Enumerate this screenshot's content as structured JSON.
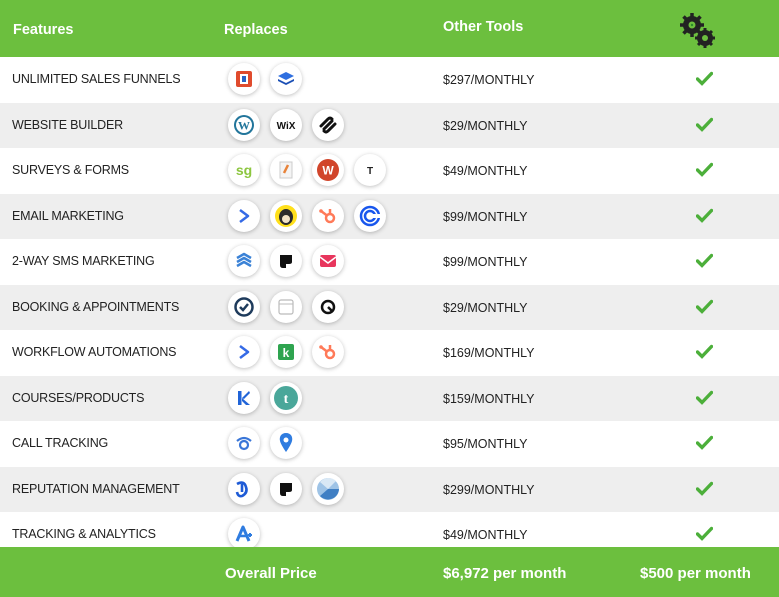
{
  "header": {
    "features": "Features",
    "replaces": "Replaces",
    "other_tools": "Other Tools",
    "logo_icon": "gears-logo-icon"
  },
  "colors": {
    "brand_green": "#6cbf3e",
    "check_green": "#4caf3a",
    "row_alt": "#eeeeee"
  },
  "rows": [
    {
      "feature": "UNLIMITED SALES FUNNELS",
      "price": "$297/MONTHLY",
      "icons": [
        "clickfunnels-icon",
        "layers-stack-icon"
      ]
    },
    {
      "feature": "WEBSITE BUILDER",
      "price": "$29/MONTHLY",
      "icons": [
        "wordpress-icon",
        "wix-icon",
        "squarespace-icon"
      ]
    },
    {
      "feature": "SURVEYS & FORMS",
      "price": "$49/MONTHLY",
      "icons": [
        "surveygizmo-icon",
        "forms-icon",
        "wufoo-icon",
        "typeform-icon"
      ]
    },
    {
      "feature": "EMAIL MARKETING",
      "price": "$99/MONTHLY",
      "icons": [
        "activecampaign-icon",
        "mailchimp-icon",
        "hubspot-icon",
        "constant-contact-icon"
      ]
    },
    {
      "feature": "2-WAY SMS MARKETING",
      "price": "$99/MONTHLY",
      "icons": [
        "stack-chevrons-icon",
        "podium-icon",
        "mail-envelope-icon"
      ]
    },
    {
      "feature": "BOOKING & APPOINTMENTS",
      "price": "$29/MONTHLY",
      "icons": [
        "clock-check-icon",
        "calendar-icon",
        "acuity-icon"
      ]
    },
    {
      "feature": "WORKFLOW AUTOMATIONS",
      "price": "$169/MONTHLY",
      "icons": [
        "activecampaign-icon",
        "keap-icon",
        "hubspot-icon"
      ]
    },
    {
      "feature": "COURSES/PRODUCTS",
      "price": "$159/MONTHLY",
      "icons": [
        "kajabi-icon",
        "teachable-icon"
      ]
    },
    {
      "feature": "CALL TRACKING",
      "price": "$95/MONTHLY",
      "icons": [
        "callrail-icon",
        "map-pin-icon"
      ]
    },
    {
      "feature": "REPUTATION MANAGEMENT",
      "price": "$299/MONTHLY",
      "icons": [
        "birdeye-icon",
        "podium-icon",
        "pie-slice-icon"
      ]
    },
    {
      "feature": "TRACKING & ANALYTICS",
      "price": "$49/MONTHLY",
      "icons": [
        "analytics-a-icon"
      ]
    }
  ],
  "footer": {
    "label": "Overall Price",
    "other_total": "$6,972 per month",
    "our_price": "$500 per month"
  }
}
